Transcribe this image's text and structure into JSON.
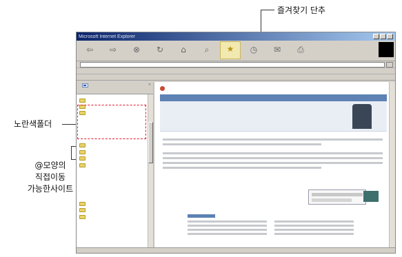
{
  "annotations": {
    "favorites_shortcut": "즐겨찾기 단추",
    "yellow_folder": "노란색폴더",
    "at_site_line1": "@모양의",
    "at_site_line2": "직접이동",
    "at_site_line3": "가능한사이트"
  },
  "browser": {
    "title": "Microsoft Internet Explorer",
    "toolbar_buttons": [
      {
        "icon": "back-icon"
      },
      {
        "icon": "forward-icon"
      },
      {
        "icon": "stop-icon"
      },
      {
        "icon": "refresh-icon"
      },
      {
        "icon": "home-icon"
      },
      {
        "icon": "search-icon"
      },
      {
        "icon": "favorites-icon",
        "highlight": true
      },
      {
        "icon": "history-icon"
      },
      {
        "icon": "mail-icon"
      },
      {
        "icon": "print-icon"
      }
    ],
    "accent": "#0a246a"
  },
  "favorites_pane": {
    "folders": [
      "",
      "",
      ""
    ],
    "sites": [
      "",
      "",
      "",
      "",
      "",
      "",
      "",
      "",
      "",
      "",
      "",
      "",
      "",
      "",
      "",
      ""
    ]
  },
  "colors": {
    "highlight_border": "#e0182c",
    "folder_yellow": "#e8d36a",
    "site_bar": "#5d82b3"
  }
}
